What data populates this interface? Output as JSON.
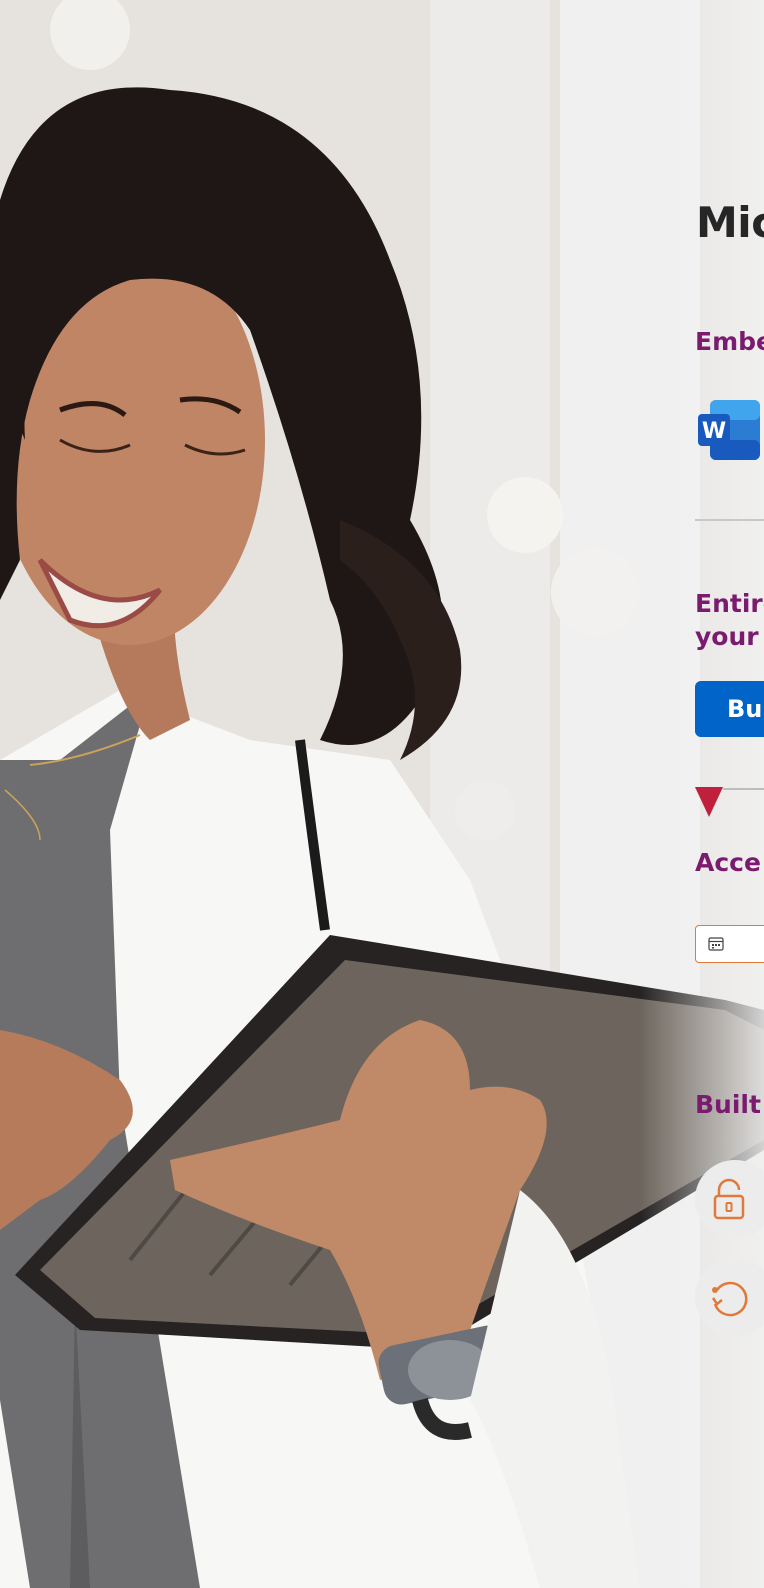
{
  "heading": {
    "title": "Mic"
  },
  "sections": {
    "embed": {
      "label": "Embe"
    },
    "entire": {
      "line1": "Entire",
      "line2": "your"
    },
    "cta": {
      "label": "Bu"
    },
    "access": {
      "label": "Acce"
    },
    "built": {
      "label": "Built"
    }
  },
  "icons": {
    "word": "word-app-icon",
    "field": "calendar-icon",
    "feature1": "unlock-icon",
    "feature2": "refresh-icon"
  },
  "colors": {
    "heading": "#262626",
    "section_label": "#7a1b6f",
    "button": "#0064c8",
    "accent_orange": "#e07a3c",
    "marker": "#c0203c"
  }
}
